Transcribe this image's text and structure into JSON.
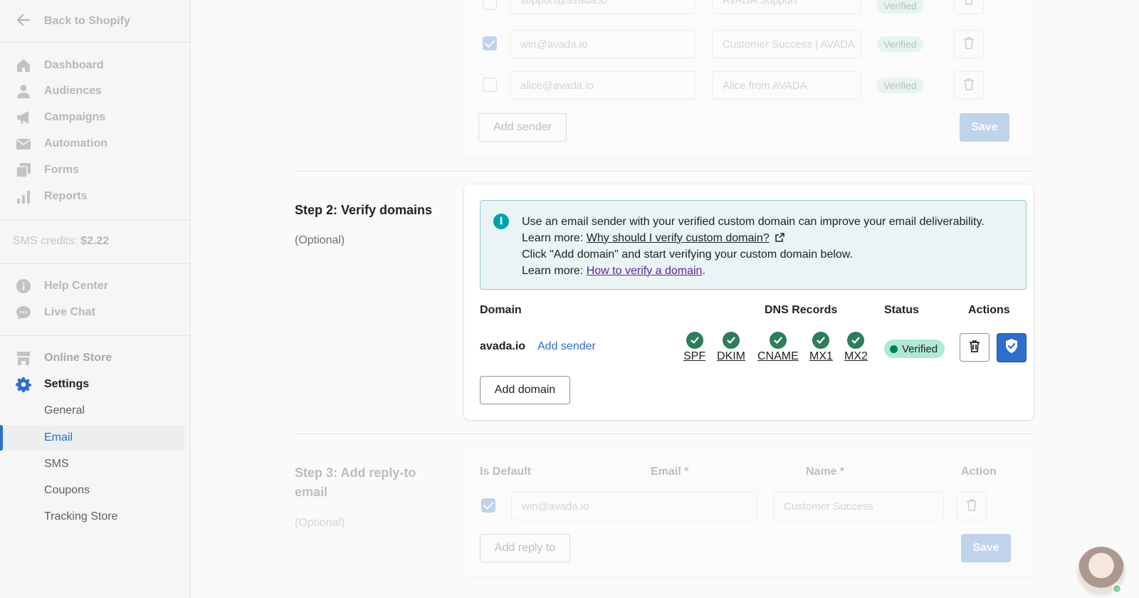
{
  "sidebar": {
    "back_label": "Back to Shopify",
    "nav": [
      {
        "label": "Dashboard",
        "icon": "home-icon"
      },
      {
        "label": "Audiences",
        "icon": "person-icon"
      },
      {
        "label": "Campaigns",
        "icon": "megaphone-icon"
      },
      {
        "label": "Automation",
        "icon": "envelope-icon"
      },
      {
        "label": "Forms",
        "icon": "forms-icon"
      },
      {
        "label": "Reports",
        "icon": "bar-chart-icon"
      }
    ],
    "sms_credits_label": "SMS credits:",
    "sms_credits_value": "$2.22",
    "support": [
      {
        "label": "Help Center",
        "icon": "info-icon"
      },
      {
        "label": "Live Chat",
        "icon": "chat-icon"
      }
    ],
    "store": {
      "label": "Online Store",
      "icon": "store-icon"
    },
    "settings": {
      "label": "Settings",
      "icon": "gear-icon"
    },
    "settings_sub": [
      "General",
      "Email",
      "SMS",
      "Coupons",
      "Tracking Store"
    ],
    "active_sub": "Email"
  },
  "step1": {
    "senders": [
      {
        "checked": false,
        "email": "support@avada.io",
        "name": "AVADA Support",
        "status": "Verified"
      },
      {
        "checked": true,
        "email": "win@avada.io",
        "name": "Customer Success | AVADA",
        "status": "Verified"
      },
      {
        "checked": false,
        "email": "alice@avada.io",
        "name": "Alice from AVADA",
        "status": "Verified"
      }
    ],
    "add_sender_label": "Add sender",
    "save_label": "Save"
  },
  "step2": {
    "title": "Step 2: Verify domains",
    "subtitle": "(Optional)",
    "banner": {
      "line1": "Use an email sender with your verified custom domain can improve your email deliverability.",
      "line2_prefix": "Learn more: ",
      "line2_link": "Why should I verify custom domain?",
      "line3": "Click \"Add domain\" and start verifying your custom domain below.",
      "line4_prefix": "Learn more: ",
      "line4_link": "How to verify a domain",
      "line4_suffix": "."
    },
    "headers": {
      "domain": "Domain",
      "dns": "DNS Records",
      "status": "Status",
      "actions": "Actions"
    },
    "row": {
      "domain": "avada.io",
      "add_sender": "Add sender",
      "records": [
        "SPF",
        "DKIM",
        "CNAME",
        "MX1",
        "MX2"
      ],
      "status": "Verified"
    },
    "add_domain_label": "Add domain"
  },
  "step3": {
    "title": "Step 3: Add reply-to email",
    "subtitle": "(Optional)",
    "headers": {
      "default": "Is Default",
      "email": "Email *",
      "name": "Name *",
      "action": "Action"
    },
    "row": {
      "checked": true,
      "email": "win@avada.io",
      "name": "Customer Success"
    },
    "add_label": "Add reply to",
    "save_label": "Save"
  },
  "colors": {
    "accent": "#2c6ecb",
    "success": "#2e7d5b",
    "badge": "#aee9d1",
    "banner_bg": "#eaf4f5"
  }
}
